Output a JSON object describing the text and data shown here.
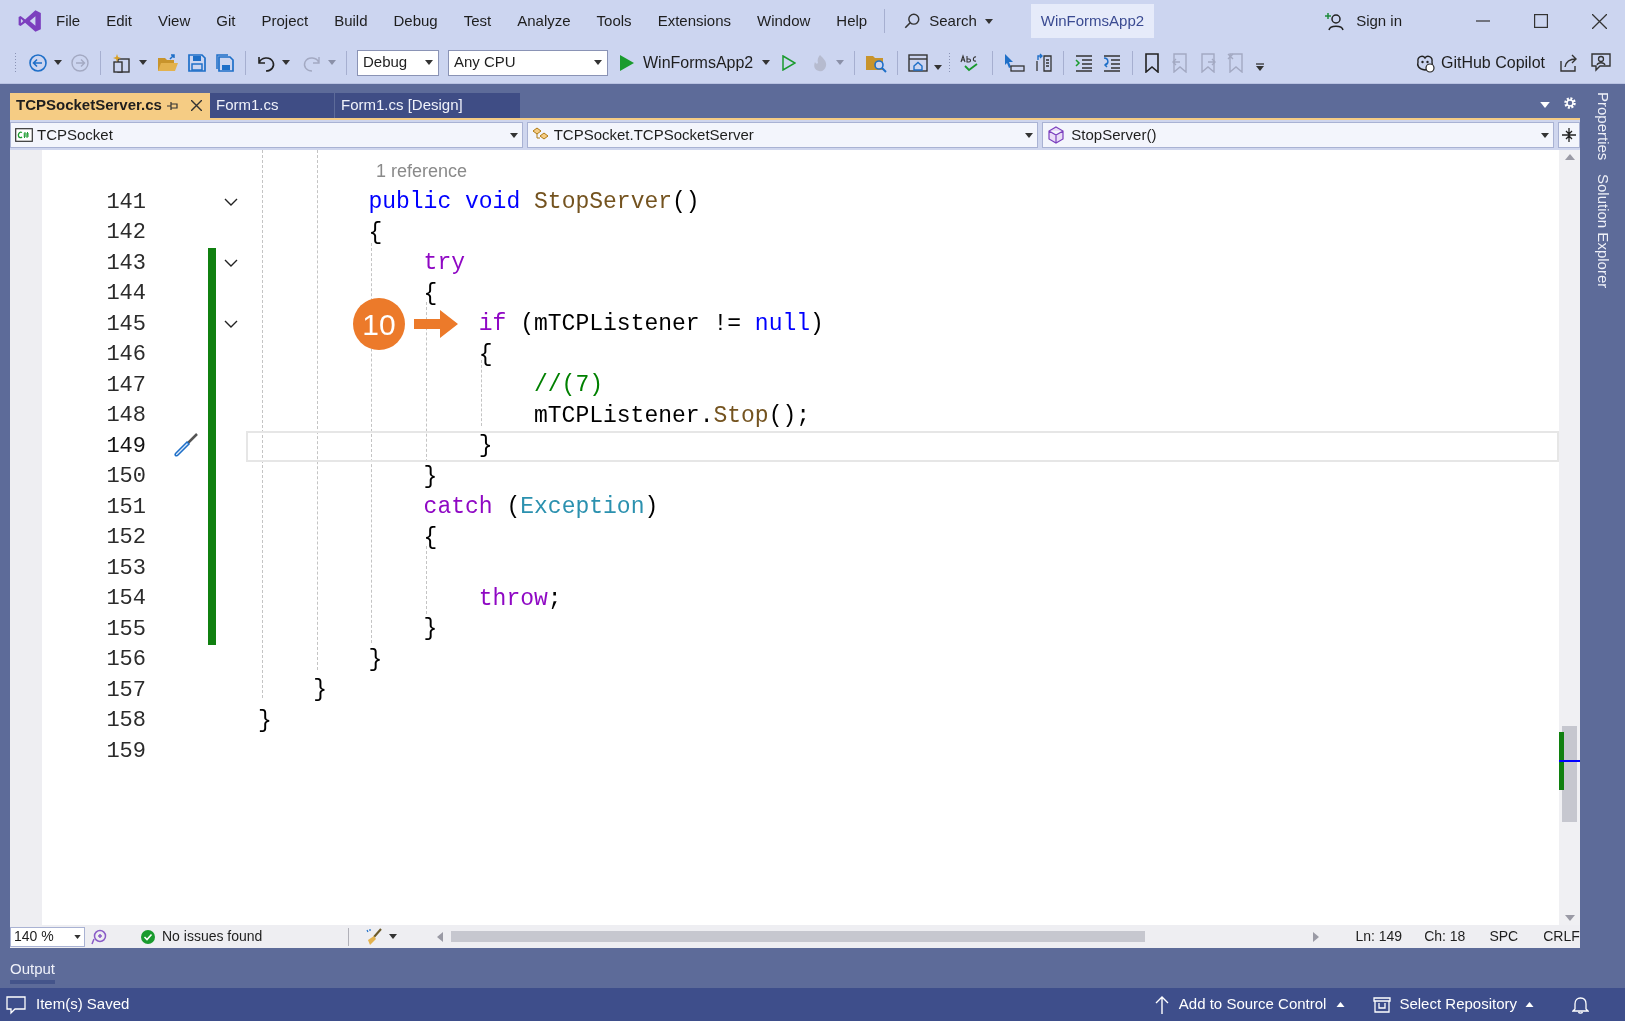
{
  "menu": [
    {
      "label": "File"
    },
    {
      "label": "Edit"
    },
    {
      "label": "View"
    },
    {
      "label": "Git"
    },
    {
      "label": "Project"
    },
    {
      "label": "Build"
    },
    {
      "label": "Debug"
    },
    {
      "label": "Test"
    },
    {
      "label": "Analyze"
    },
    {
      "label": "Tools"
    },
    {
      "label": "Extensions"
    },
    {
      "label": "Window"
    },
    {
      "label": "Help"
    }
  ],
  "search": {
    "label": "Search"
  },
  "solution_name": "WinFormsApp2",
  "sign_in": "Sign in",
  "toolbar": {
    "configuration": "Debug",
    "platform": "Any CPU",
    "startup": "WinFormsApp2",
    "copilot": "GitHub Copilot"
  },
  "tabs": [
    {
      "label": "TCPSocketServer.cs",
      "selected": true
    },
    {
      "label": "Form1.cs",
      "selected": false
    },
    {
      "label": "Form1.cs [Design]",
      "selected": false
    }
  ],
  "nav_bar": {
    "project": "TCPSocket",
    "class": "TCPSocket.TCPSocketServer",
    "member": "StopServer()"
  },
  "side_tabs": [
    "Properties",
    "Solution Explorer"
  ],
  "editor": {
    "code_lens": "1 reference",
    "lines": [
      {
        "number": "141",
        "fold_toggle": true,
        "changed": false,
        "current": false,
        "quick_actions": false,
        "tokens": [
          {
            "kind": "keyword",
            "text": "        public void"
          },
          {
            "kind": "method",
            "text": " StopServer"
          },
          {
            "kind": "plain",
            "text": "()"
          }
        ]
      },
      {
        "number": "142",
        "fold_toggle": false,
        "changed": false,
        "current": false,
        "quick_actions": false,
        "tokens": [
          {
            "kind": "plain",
            "text": "        {"
          }
        ]
      },
      {
        "number": "143",
        "fold_toggle": true,
        "changed": true,
        "current": false,
        "quick_actions": false,
        "tokens": [
          {
            "kind": "control",
            "text": "            try"
          }
        ]
      },
      {
        "number": "144",
        "fold_toggle": false,
        "changed": true,
        "current": false,
        "quick_actions": false,
        "tokens": [
          {
            "kind": "plain",
            "text": "            {"
          }
        ]
      },
      {
        "number": "145",
        "fold_toggle": true,
        "changed": true,
        "current": false,
        "quick_actions": false,
        "callout": "10",
        "tokens": [
          {
            "kind": "control",
            "text": "                if"
          },
          {
            "kind": "plain",
            "text": " (mTCPListener != "
          },
          {
            "kind": "keyword",
            "text": "null"
          },
          {
            "kind": "plain",
            "text": ")"
          }
        ]
      },
      {
        "number": "146",
        "fold_toggle": false,
        "changed": true,
        "current": false,
        "quick_actions": false,
        "tokens": [
          {
            "kind": "plain",
            "text": "                {"
          }
        ]
      },
      {
        "number": "147",
        "fold_toggle": false,
        "changed": true,
        "current": false,
        "quick_actions": false,
        "tokens": [
          {
            "kind": "comment",
            "text": "                    //(7)"
          }
        ]
      },
      {
        "number": "148",
        "fold_toggle": false,
        "changed": true,
        "current": false,
        "quick_actions": false,
        "tokens": [
          {
            "kind": "plain",
            "text": "                    mTCPListener."
          },
          {
            "kind": "method",
            "text": "Stop"
          },
          {
            "kind": "plain",
            "text": "();"
          }
        ]
      },
      {
        "number": "149",
        "fold_toggle": false,
        "changed": true,
        "current": true,
        "quick_actions": true,
        "tokens": [
          {
            "kind": "plain",
            "text": "                }"
          }
        ]
      },
      {
        "number": "150",
        "fold_toggle": false,
        "changed": true,
        "current": false,
        "quick_actions": false,
        "tokens": [
          {
            "kind": "plain",
            "text": "            }"
          }
        ]
      },
      {
        "number": "151",
        "fold_toggle": false,
        "changed": true,
        "current": false,
        "quick_actions": false,
        "tokens": [
          {
            "kind": "control",
            "text": "            catch"
          },
          {
            "kind": "plain",
            "text": " ("
          },
          {
            "kind": "type",
            "text": "Exception"
          },
          {
            "kind": "plain",
            "text": ")"
          }
        ]
      },
      {
        "number": "152",
        "fold_toggle": false,
        "changed": true,
        "current": false,
        "quick_actions": false,
        "tokens": [
          {
            "kind": "plain",
            "text": "            {"
          }
        ]
      },
      {
        "number": "153",
        "fold_toggle": false,
        "changed": true,
        "current": false,
        "quick_actions": false
      },
      {
        "number": "154",
        "fold_toggle": false,
        "changed": true,
        "current": false,
        "quick_actions": false,
        "tokens": [
          {
            "kind": "control",
            "text": "                throw"
          },
          {
            "kind": "plain",
            "text": ";"
          }
        ]
      },
      {
        "number": "155",
        "fold_toggle": false,
        "changed": true,
        "current": false,
        "quick_actions": false,
        "tokens": [
          {
            "kind": "plain",
            "text": "            }"
          }
        ]
      },
      {
        "number": "156",
        "fold_toggle": false,
        "changed": false,
        "current": false,
        "quick_actions": false,
        "tokens": [
          {
            "kind": "plain",
            "text": "        }"
          }
        ]
      },
      {
        "number": "157",
        "fold_toggle": false,
        "changed": false,
        "current": false,
        "quick_actions": false,
        "tokens": [
          {
            "kind": "plain",
            "text": "    }"
          }
        ]
      },
      {
        "number": "158",
        "fold_toggle": false,
        "changed": false,
        "current": false,
        "quick_actions": false,
        "tokens": [
          {
            "kind": "plain",
            "text": "}"
          }
        ]
      },
      {
        "number": "159",
        "fold_toggle": false,
        "changed": false,
        "current": false,
        "quick_actions": false
      }
    ]
  },
  "editor_status": {
    "zoom": "140 %",
    "issues": "No issues found",
    "line": "Ln: 149",
    "column": "Ch: 18",
    "whitespace": "SPC",
    "line_ending": "CRLF"
  },
  "output_panel": {
    "title": "Output"
  },
  "status_bar": {
    "message": "Item(s) Saved",
    "source_control": "Add to Source Control",
    "repository": "Select Repository"
  }
}
